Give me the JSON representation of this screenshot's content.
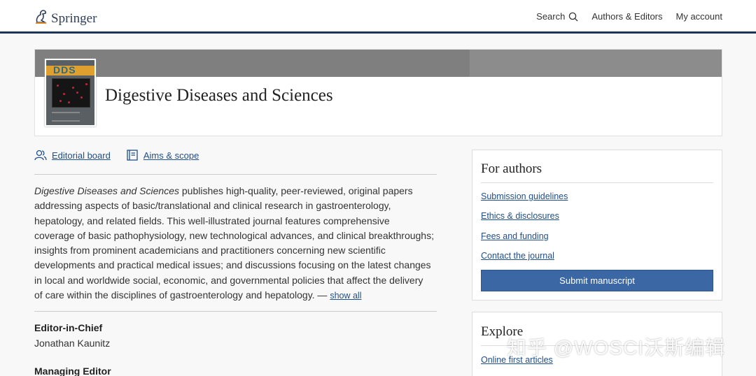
{
  "header": {
    "brand": "Springer",
    "nav": [
      {
        "label": "Search"
      },
      {
        "label": "Authors & Editors"
      },
      {
        "label": "My account"
      }
    ]
  },
  "journal": {
    "title": "Digestive Diseases and Sciences",
    "cover_abbrev": "DDS"
  },
  "quick_links": [
    {
      "label": "Editorial board"
    },
    {
      "label": "Aims & scope"
    }
  ],
  "description": {
    "journal_name": "Digestive Diseases and Sciences",
    "lines": [
      " publishes high-quality, peer-reviewed, original papers",
      "addressing aspects of basic/translational and clinical research in gastroenterology,",
      "hepatology, and related fields. This well-illustrated journal features comprehensive",
      "coverage of basic pathophysiology, new technological advances, and clinical breakthroughs;",
      "insights from prominent academicians and practitioners concerning new scientific",
      "developments and practical medical issues; and discussions focusing on the latest changes",
      "in local and worldwide social, economic, and governmental policies that affect the delivery",
      "of care within the disciplines of gastroenterology and hepatology. — "
    ],
    "show_all": "show all"
  },
  "editors": [
    {
      "role": "Editor-in-Chief",
      "name": "Jonathan Kaunitz"
    },
    {
      "role": "Managing Editor",
      "name": ""
    }
  ],
  "for_authors": {
    "title": "For authors",
    "links": [
      "Submission guidelines",
      "Ethics & disclosures",
      "Fees and funding",
      "Contact the journal"
    ],
    "submit_label": "Submit manuscript"
  },
  "explore": {
    "title": "Explore",
    "links": [
      "Online first articles"
    ]
  },
  "watermark": "知乎 @WOSCI沃斯编辑",
  "colors": {
    "accent": "#1d3557",
    "link": "#1f4e89",
    "button": "#3b67a5"
  }
}
